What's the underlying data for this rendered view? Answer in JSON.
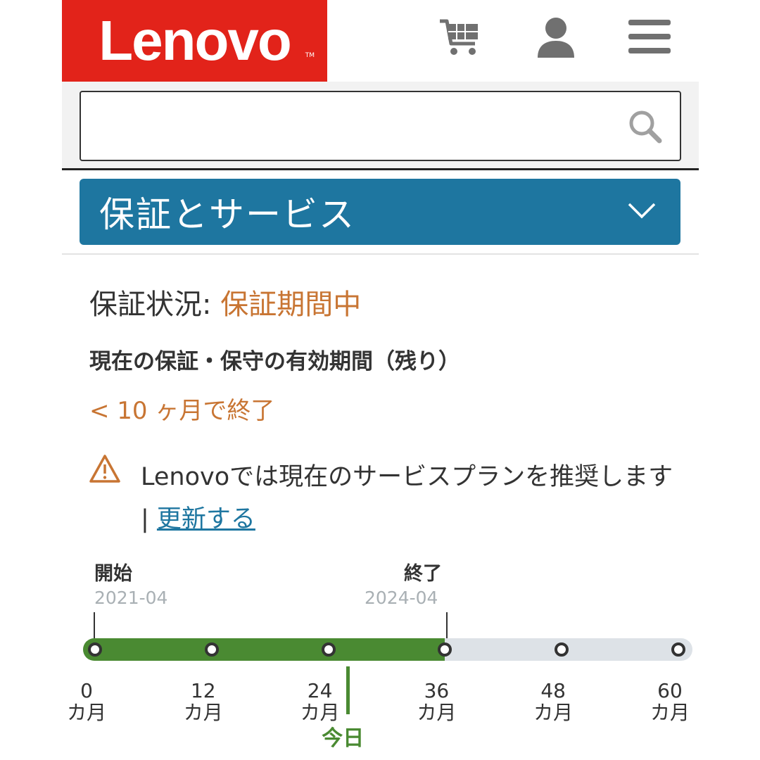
{
  "header": {
    "logo_text": "Lenovo",
    "logo_tm": "TM",
    "icons": [
      "cart-icon",
      "user-icon",
      "menu-icon"
    ]
  },
  "search": {
    "value": "",
    "placeholder": ""
  },
  "accordion": {
    "title": "保証とサービス",
    "icon": "chevron-down-icon"
  },
  "warranty": {
    "status_label": "保証状況: ",
    "status_value": "保証期間中",
    "remaining_title": "現在の保証・保守の有効期間（残り）",
    "remaining_value": "< 10 ヶ月で終了"
  },
  "notice": {
    "text": "Lenovoでは現在のサービスプランを推奨します | ",
    "link_label": "更新する"
  },
  "timeline": {
    "start_label": "開始",
    "start_date": "2021-04",
    "end_label": "終了",
    "end_date": "2024-04",
    "months": [
      "0",
      "12",
      "24",
      "36",
      "48",
      "60"
    ],
    "month_unit": "カ月",
    "today_label": "今日",
    "range_months": [
      0,
      60
    ],
    "covered_end_months": 36,
    "today_months": 26
  },
  "colors": {
    "brand_red": "#e2231a",
    "accordion_blue": "#1e76a0",
    "status_orange": "#c87533",
    "progress_green": "#4a8a32",
    "track_grey": "#dde2e7"
  }
}
